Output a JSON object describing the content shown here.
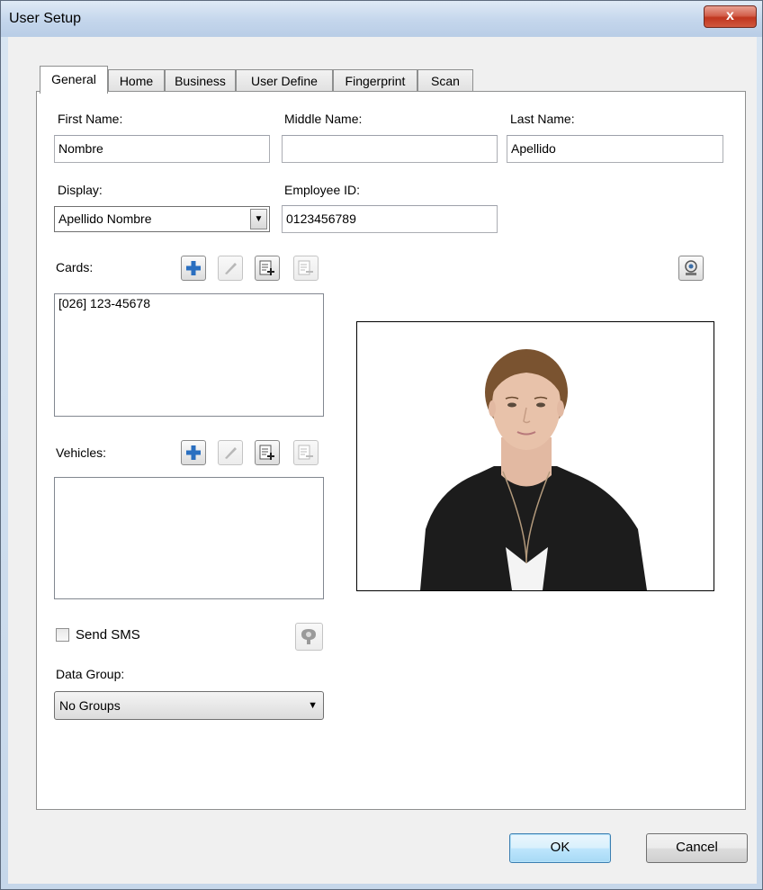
{
  "window": {
    "title": "User Setup",
    "close_label": "x"
  },
  "tabs": [
    {
      "label": "General",
      "active": true
    },
    {
      "label": "Home",
      "active": false
    },
    {
      "label": "Business",
      "active": false
    },
    {
      "label": "User Define",
      "active": false
    },
    {
      "label": "Fingerprint",
      "active": false
    },
    {
      "label": "Scan",
      "active": false
    }
  ],
  "form": {
    "first_name_label": "First Name:",
    "first_name_value": "Nombre",
    "middle_name_label": "Middle Name:",
    "middle_name_value": "",
    "last_name_label": "Last Name:",
    "last_name_value": "Apellido",
    "display_label": "Display:",
    "display_value": "Apellido Nombre",
    "employee_id_label": "Employee ID:",
    "employee_id_value": "0123456789"
  },
  "cards": {
    "label": "Cards:",
    "items": [
      "[026] 123-45678"
    ]
  },
  "vehicles": {
    "label": "Vehicles:",
    "items": []
  },
  "sms": {
    "label": "Send SMS",
    "checked": false
  },
  "data_group": {
    "label": "Data Group:",
    "value": "No Groups"
  },
  "toolbar_icons": [
    "add-icon",
    "edit-icon",
    "import-list-icon",
    "remove-list-icon",
    "webcam-icon",
    "sms-profile-icon"
  ],
  "footer": {
    "ok_label": "OK",
    "cancel_label": "Cancel"
  },
  "colors": {
    "add_icon": "#2a6fc0",
    "title_bar": "#c4d6ec",
    "close_button": "#c0361f",
    "default_button_border": "#3c7fb1"
  }
}
